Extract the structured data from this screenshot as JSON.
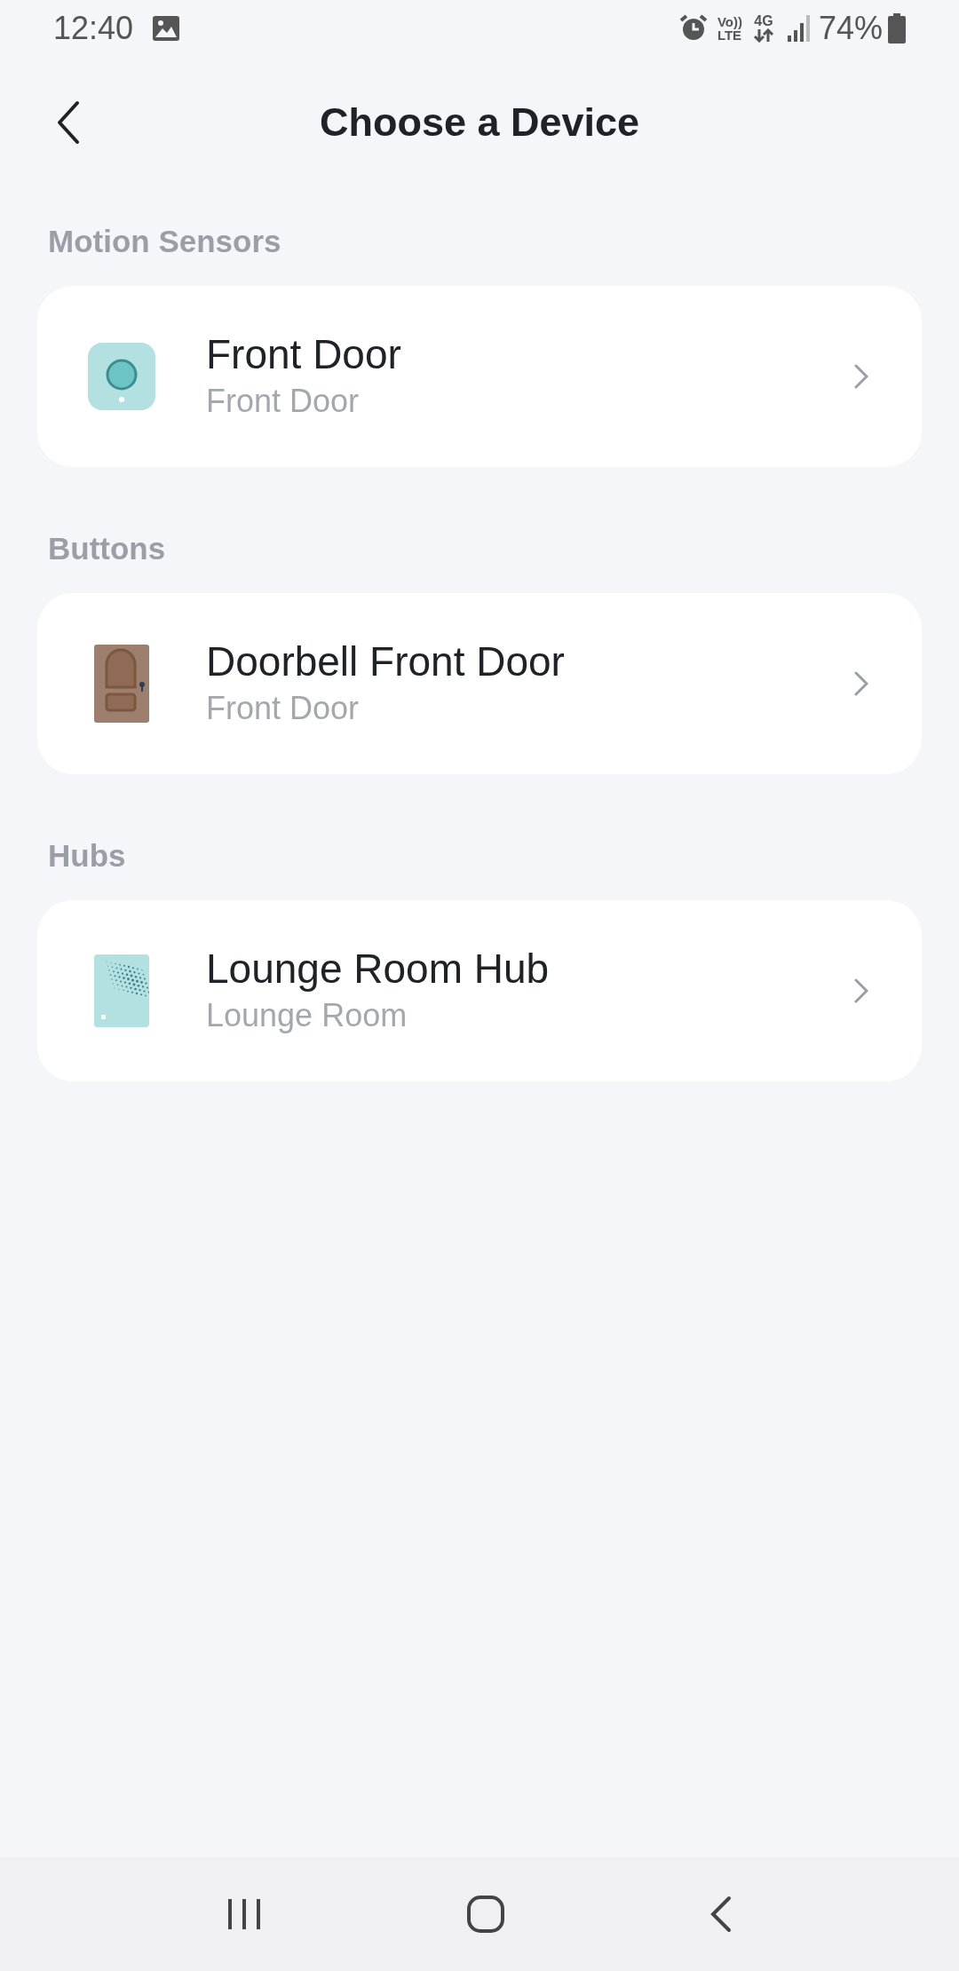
{
  "status_bar": {
    "time": "12:40",
    "volte": "Vo))",
    "lte": "LTE",
    "network": "4G",
    "battery": "74%"
  },
  "header": {
    "title": "Choose a Device"
  },
  "sections": [
    {
      "title": "Motion Sensors",
      "devices": [
        {
          "kind": "sensor",
          "name": "Front Door",
          "room": "Front Door"
        }
      ]
    },
    {
      "title": "Buttons",
      "devices": [
        {
          "kind": "door",
          "name": "Doorbell Front Door",
          "room": "Front Door"
        }
      ]
    },
    {
      "title": "Hubs",
      "devices": [
        {
          "kind": "hub",
          "name": "Lounge Room Hub",
          "room": "Lounge Room"
        }
      ]
    }
  ]
}
